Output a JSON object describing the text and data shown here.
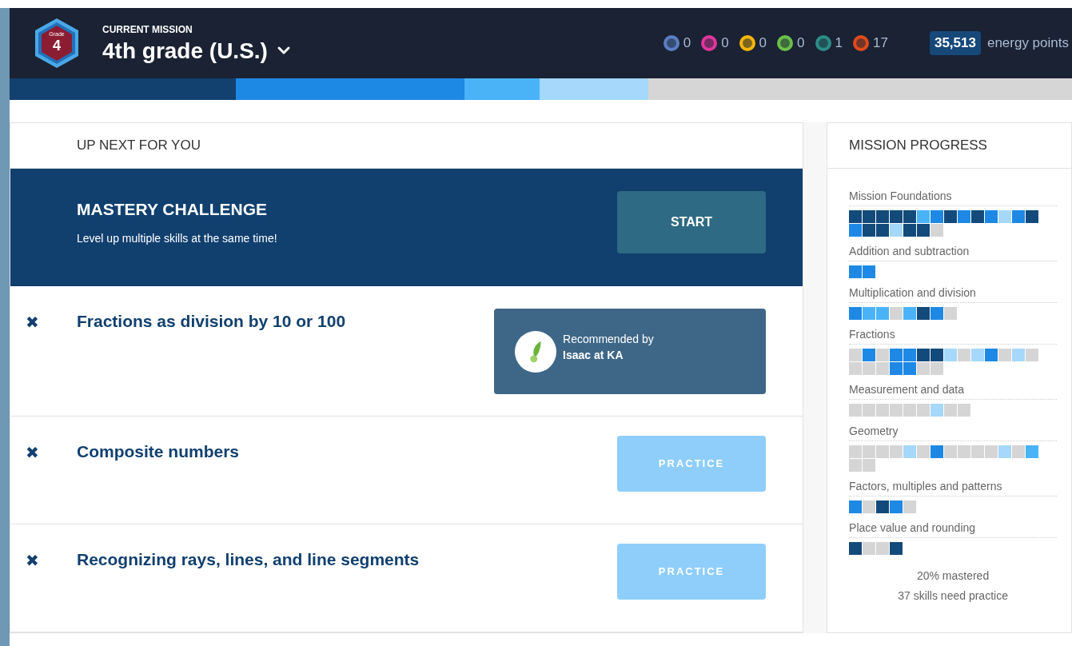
{
  "header": {
    "grade_badge": {
      "label": "Grade",
      "number": "4"
    },
    "eyebrow": "CURRENT MISSION",
    "mission": "4th grade (U.S.)",
    "badges": [
      {
        "color": "#5b7fc4",
        "count": "0"
      },
      {
        "color": "#e0369b",
        "count": "0"
      },
      {
        "color": "#f5b50a",
        "count": "0"
      },
      {
        "color": "#6cc04a",
        "count": "0"
      },
      {
        "color": "#2c8c86",
        "count": "1"
      },
      {
        "color": "#e04a1c",
        "count": "17"
      }
    ],
    "points": "35,513",
    "points_label": "energy points"
  },
  "mission_bar": [
    {
      "color": "#12406f"
    },
    {
      "color": "#1e88e5"
    },
    {
      "color": "#4ab3f7"
    },
    {
      "color": "#a5d8fb"
    }
  ],
  "up_next": {
    "title": "UP NEXT FOR YOU",
    "challenge": {
      "title": "MASTERY CHALLENGE",
      "subtitle": "Level up multiple skills at the same time!",
      "button": "START"
    },
    "items": [
      {
        "close": "✖",
        "title": "Fractions as division by 10 or 100",
        "kind": "recommended",
        "line1": "Recommended by",
        "line2": "Isaac at KA"
      },
      {
        "close": "✖",
        "title": "Composite numbers",
        "kind": "practice",
        "button": "PRACTICE"
      },
      {
        "close": "✖",
        "title": "Recognizing rays, lines, and line segments",
        "kind": "practice",
        "button": "PRACTICE"
      }
    ]
  },
  "progress": {
    "title": "MISSION PROGRESS",
    "groups": [
      {
        "name": "Mission Foundations",
        "squares": [
          {
            "color": "#134a7c"
          },
          {
            "color": "#134a7c"
          },
          {
            "color": "#134a7c"
          },
          {
            "color": "#134a7c"
          },
          {
            "color": "#134a7c"
          },
          {
            "color": "#4ab3f7"
          },
          {
            "color": "#1e88e5"
          },
          {
            "color": "#134a7c"
          },
          {
            "color": "#1e88e5"
          },
          {
            "color": "#134a7c"
          },
          {
            "color": "#1e88e5"
          },
          {
            "color": "#a5d8fb"
          },
          {
            "color": "#1e88e5"
          },
          {
            "color": "#134a7c"
          },
          {
            "color": "#1e88e5"
          },
          {
            "color": "#134a7c"
          },
          {
            "color": "#134a7c"
          },
          {
            "color": "#a5d8fb"
          },
          {
            "color": "#134a7c"
          },
          {
            "color": "#134a7c"
          },
          {
            "color": "#d5d5d5"
          }
        ]
      },
      {
        "name": "Addition and subtraction",
        "squares": [
          {
            "color": "#1e88e5"
          },
          {
            "color": "#1e88e5"
          }
        ]
      },
      {
        "name": "Multiplication and division",
        "squares": [
          {
            "color": "#1e88e5"
          },
          {
            "color": "#4ab3f7"
          },
          {
            "color": "#4ab3f7"
          },
          {
            "color": "#d5d5d5"
          },
          {
            "color": "#4ab3f7"
          },
          {
            "color": "#134a7c"
          },
          {
            "color": "#1e88e5"
          },
          {
            "color": "#d5d5d5"
          }
        ]
      },
      {
        "name": "Fractions",
        "squares": [
          {
            "color": "#d5d5d5"
          },
          {
            "color": "#1e88e5"
          },
          {
            "color": "#d5d5d5"
          },
          {
            "color": "#1e88e5"
          },
          {
            "color": "#1e88e5"
          },
          {
            "color": "#134a7c"
          },
          {
            "color": "#134a7c"
          },
          {
            "color": "#a5d8fb"
          },
          {
            "color": "#d5d5d5"
          },
          {
            "color": "#a5d8fb"
          },
          {
            "color": "#1e88e5"
          },
          {
            "color": "#d5d5d5"
          },
          {
            "color": "#a5d8fb"
          },
          {
            "color": "#d5d5d5"
          },
          {
            "color": "#d5d5d5"
          },
          {
            "color": "#d5d5d5"
          },
          {
            "color": "#d5d5d5"
          },
          {
            "color": "#1e88e5"
          },
          {
            "color": "#1e88e5"
          },
          {
            "color": "#d5d5d5"
          },
          {
            "color": "#d5d5d5"
          }
        ]
      },
      {
        "name": "Measurement and data",
        "squares": [
          {
            "color": "#d5d5d5"
          },
          {
            "color": "#d5d5d5"
          },
          {
            "color": "#d5d5d5"
          },
          {
            "color": "#d5d5d5"
          },
          {
            "color": "#d5d5d5"
          },
          {
            "color": "#d5d5d5"
          },
          {
            "color": "#a5d8fb"
          },
          {
            "color": "#d5d5d5"
          },
          {
            "color": "#d5d5d5"
          }
        ]
      },
      {
        "name": "Geometry",
        "squares": [
          {
            "color": "#d5d5d5"
          },
          {
            "color": "#d5d5d5"
          },
          {
            "color": "#d5d5d5"
          },
          {
            "color": "#d5d5d5"
          },
          {
            "color": "#a5d8fb"
          },
          {
            "color": "#d5d5d5"
          },
          {
            "color": "#1e88e5"
          },
          {
            "color": "#d5d5d5"
          },
          {
            "color": "#d5d5d5"
          },
          {
            "color": "#d5d5d5"
          },
          {
            "color": "#d5d5d5"
          },
          {
            "color": "#a5d8fb"
          },
          {
            "color": "#d5d5d5"
          },
          {
            "color": "#4ab3f7"
          },
          {
            "color": "#d5d5d5"
          },
          {
            "color": "#d5d5d5"
          }
        ]
      },
      {
        "name": "Factors, multiples and patterns",
        "squares": [
          {
            "color": "#1e88e5"
          },
          {
            "color": "#d5d5d5"
          },
          {
            "color": "#134a7c"
          },
          {
            "color": "#1e88e5"
          },
          {
            "color": "#d5d5d5"
          }
        ]
      },
      {
        "name": "Place value and rounding",
        "squares": [
          {
            "color": "#134a7c"
          },
          {
            "color": "#d5d5d5"
          },
          {
            "color": "#d5d5d5"
          },
          {
            "color": "#134a7c"
          }
        ]
      }
    ],
    "mastered": "20% mastered",
    "need_practice": "37 skills need practice"
  }
}
